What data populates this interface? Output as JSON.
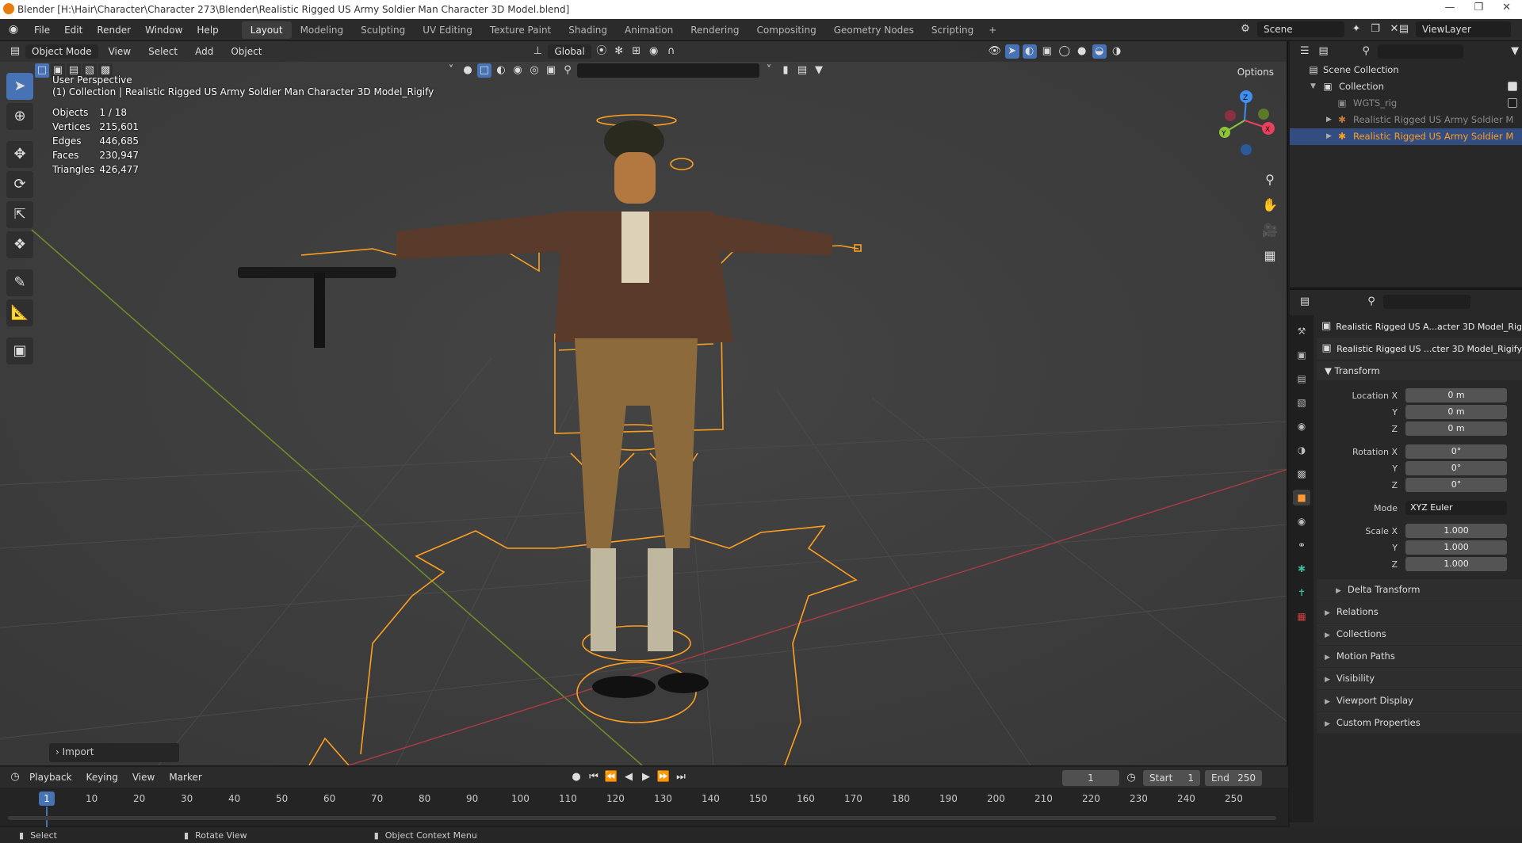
{
  "window": {
    "title": "Blender [H:\\Hair\\Character\\Character 273\\Blender\\Realistic Rigged US Army Soldier Man Character 3D Model.blend]"
  },
  "menu": [
    "File",
    "Edit",
    "Render",
    "Window",
    "Help"
  ],
  "workspaces": [
    {
      "label": "Layout",
      "active": true
    },
    {
      "label": "Modeling",
      "active": false
    },
    {
      "label": "Sculpting",
      "active": false
    },
    {
      "label": "UV Editing",
      "active": false
    },
    {
      "label": "Texture Paint",
      "active": false
    },
    {
      "label": "Shading",
      "active": false
    },
    {
      "label": "Animation",
      "active": false
    },
    {
      "label": "Rendering",
      "active": false
    },
    {
      "label": "Compositing",
      "active": false
    },
    {
      "label": "Geometry Nodes",
      "active": false
    },
    {
      "label": "Scripting",
      "active": false
    }
  ],
  "scene": {
    "name": "Scene"
  },
  "view_layer": {
    "name": "ViewLayer"
  },
  "viewport": {
    "mode": "Object Mode",
    "menus": [
      "View",
      "Select",
      "Add",
      "Object"
    ],
    "orientation": "Global",
    "options_label": "Options",
    "perspective_label": "User Perspective",
    "active_info": "(1) Collection | Realistic Rigged US Army Soldier Man Character 3D Model_Rigify",
    "stats": [
      {
        "label": "Objects",
        "value": "1 / 18"
      },
      {
        "label": "Vertices",
        "value": "215,601"
      },
      {
        "label": "Edges",
        "value": "446,685"
      },
      {
        "label": "Faces",
        "value": "230,947"
      },
      {
        "label": "Triangles",
        "value": "426,477"
      }
    ],
    "gizmo_labels": {
      "x": "X",
      "y": "Y",
      "z": "Z"
    },
    "import_panel": "Import"
  },
  "timeline": {
    "menus": [
      "Playback",
      "Keying",
      "View",
      "Marker"
    ],
    "current_frame": "1",
    "start_label": "Start",
    "start": "1",
    "end_label": "End",
    "end": "250",
    "ticks": [
      "10",
      "20",
      "30",
      "40",
      "50",
      "60",
      "70",
      "80",
      "90",
      "100",
      "110",
      "120",
      "130",
      "140",
      "150",
      "160",
      "170",
      "180",
      "190",
      "200",
      "210",
      "220",
      "230",
      "240",
      "250"
    ]
  },
  "status_bar": {
    "select": "Select",
    "rotate": "Rotate View",
    "context": "Object Context Menu"
  },
  "outliner": {
    "rows": [
      {
        "label": "Scene Collection",
        "indent": 0,
        "icon": "scene-collection-icon",
        "style": "normal"
      },
      {
        "label": "Collection",
        "indent": 1,
        "icon": "collection-icon",
        "style": "normal",
        "checked": true
      },
      {
        "label": "WGTS_rig",
        "indent": 2,
        "icon": "collection-icon",
        "style": "dim",
        "checked": false
      },
      {
        "label": "Realistic Rigged US Army Soldier M",
        "indent": 2,
        "icon": "armature-icon",
        "style": "dim"
      },
      {
        "label": "Realistic Rigged US Army Soldier M",
        "indent": 2,
        "icon": "armature-icon",
        "style": "sel"
      }
    ]
  },
  "properties": {
    "object_name_top": "Realistic Rigged US A...acter 3D Model_Rigify",
    "object_name_field": "Realistic Rigged US ...cter 3D Model_Rigify",
    "transform_title": "Transform",
    "location": {
      "x_label": "Location X",
      "x": "0 m",
      "y_label": "Y",
      "y": "0 m",
      "z_label": "Z",
      "z": "0 m"
    },
    "rotation": {
      "x_label": "Rotation X",
      "x": "0°",
      "y_label": "Y",
      "y": "0°",
      "z_label": "Z",
      "z": "0°"
    },
    "mode": {
      "label": "Mode",
      "value": "XYZ Euler"
    },
    "scale": {
      "x_label": "Scale X",
      "x": "1.000",
      "y_label": "Y",
      "y": "1.000",
      "z_label": "Z",
      "z": "1.000"
    },
    "delta_transform": "Delta Transform",
    "panels": [
      "Relations",
      "Collections",
      "Motion Paths",
      "Visibility",
      "Viewport Display",
      "Custom Properties"
    ]
  },
  "colors": {
    "accent": "#4772b3",
    "selection_orange": "#ff9f20",
    "axis_x": "#e8405e",
    "axis_y": "#8cc43a",
    "axis_z": "#3f8ef0"
  }
}
